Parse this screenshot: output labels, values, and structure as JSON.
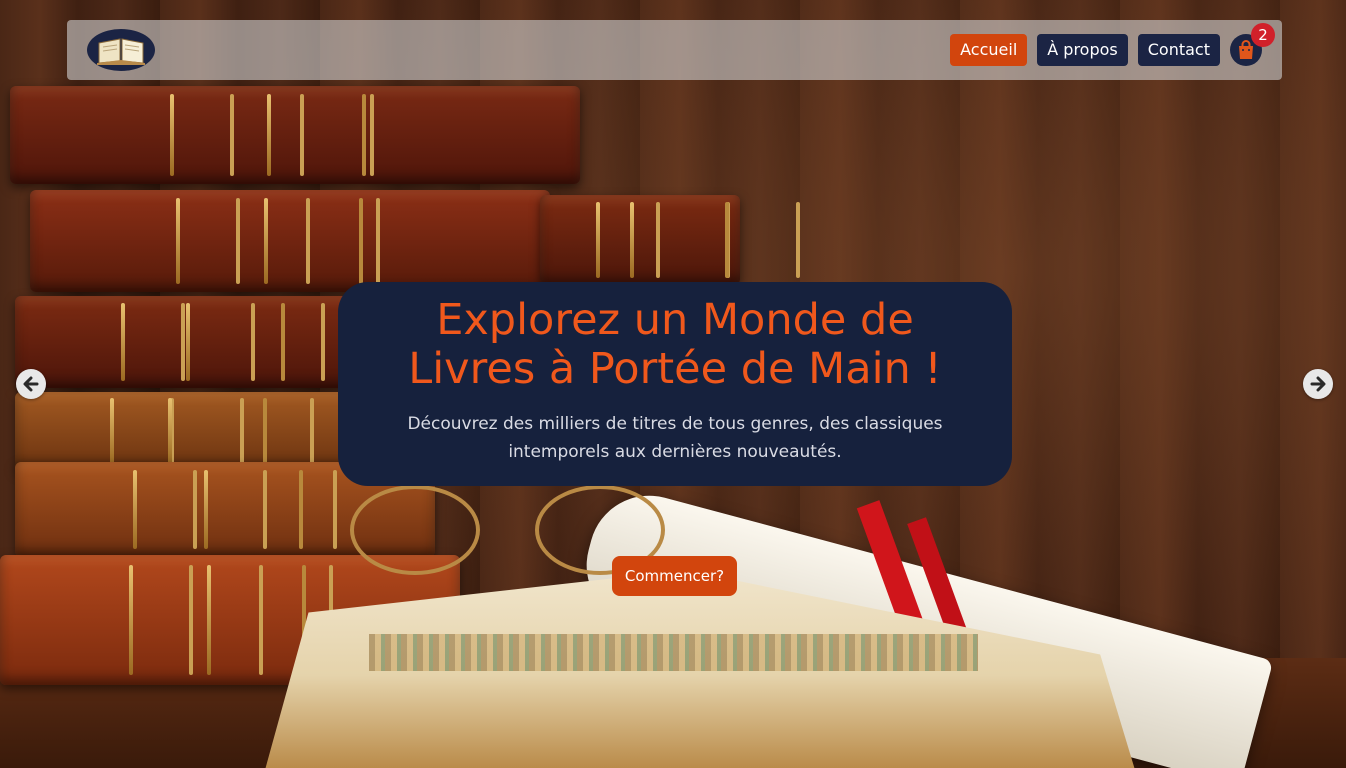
{
  "nav": {
    "logo_icon": "open-book-icon",
    "links": [
      {
        "label": "Accueil",
        "active": true
      },
      {
        "label": "À propos",
        "active": false
      },
      {
        "label": "Contact",
        "active": false
      }
    ],
    "cart_icon": "shopping-bag-icon",
    "cart_count": "2"
  },
  "hero": {
    "title_line1": "Explorez un Monde de",
    "title_line2": "Livres à Portée de Main !",
    "subtitle_line1": "Découvrez des milliers de titres de tous genres, des classiques",
    "subtitle_line2": "intemporels aux dernières nouveautés.",
    "cta_label": "Commencer?"
  },
  "carousel": {
    "prev_icon": "arrow-left-icon",
    "next_icon": "arrow-right-icon"
  },
  "colors": {
    "accent": "#d2450d",
    "navy": "#1b2444",
    "title_orange": "#f0581c",
    "badge_red": "#d1202a"
  }
}
